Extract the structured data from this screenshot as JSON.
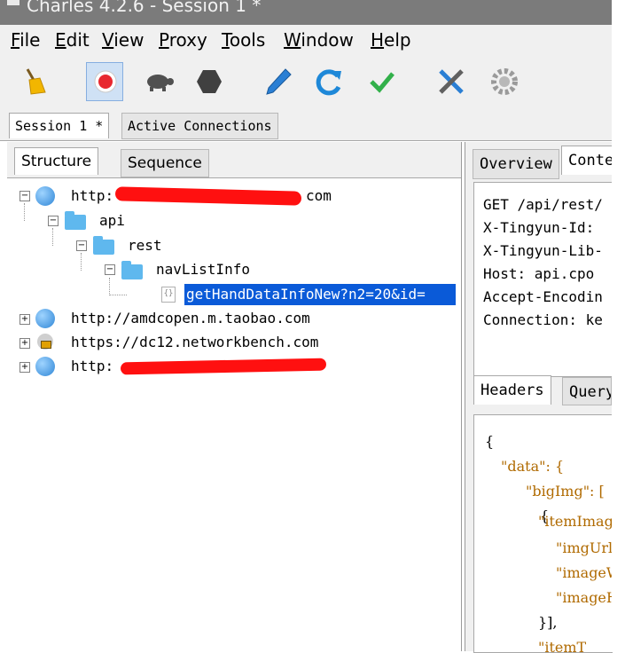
{
  "window": {
    "title": "Charles 4.2.6 - Session 1 *"
  },
  "menu": [
    "File",
    "Edit",
    "View",
    "Proxy",
    "Tools",
    "Window",
    "Help"
  ],
  "toolbar": {
    "buttons": [
      "broom-icon",
      "record-icon",
      "turtle-icon",
      "stop-icon",
      "pen-icon",
      "refresh-icon",
      "check-icon",
      "tools-icon",
      "gear-icon"
    ]
  },
  "session_tabs": [
    "Session 1 *",
    "Active Connections"
  ],
  "left_tabs": [
    "Structure",
    "Sequence"
  ],
  "tree": {
    "host1_prefix": "http:",
    "host1_suffix": "com",
    "api": "api",
    "rest": "rest",
    "navlist": "navListInfo",
    "selected_request": "getHandDataInfoNew?n2=20&id=",
    "host2": "http://amdcopen.m.taobao.com",
    "host3": "https://dc12.networkbench.com",
    "host4_prefix": "http:"
  },
  "right_tabs": [
    "Overview",
    "Contents"
  ],
  "request_lines": [
    "GET /api/rest/",
    "X-Tingyun-Id:",
    "X-Tingyun-Lib-",
    "Host: api.cpo",
    "Accept-Encodin",
    "Connection: ke"
  ],
  "response_tabs": [
    "Headers",
    "Query"
  ],
  "json_lines": [
    "{",
    "\"data\": {",
    "\"bigImg\": [",
    "{",
    "\"itemImage",
    "\"imgUrl",
    "\"imageW",
    "\"imageH",
    "}],",
    "\"itemT"
  ],
  "colors": {
    "selection": "#0a5ad8",
    "redaction": "#ff1010",
    "record": "#e8282f"
  }
}
